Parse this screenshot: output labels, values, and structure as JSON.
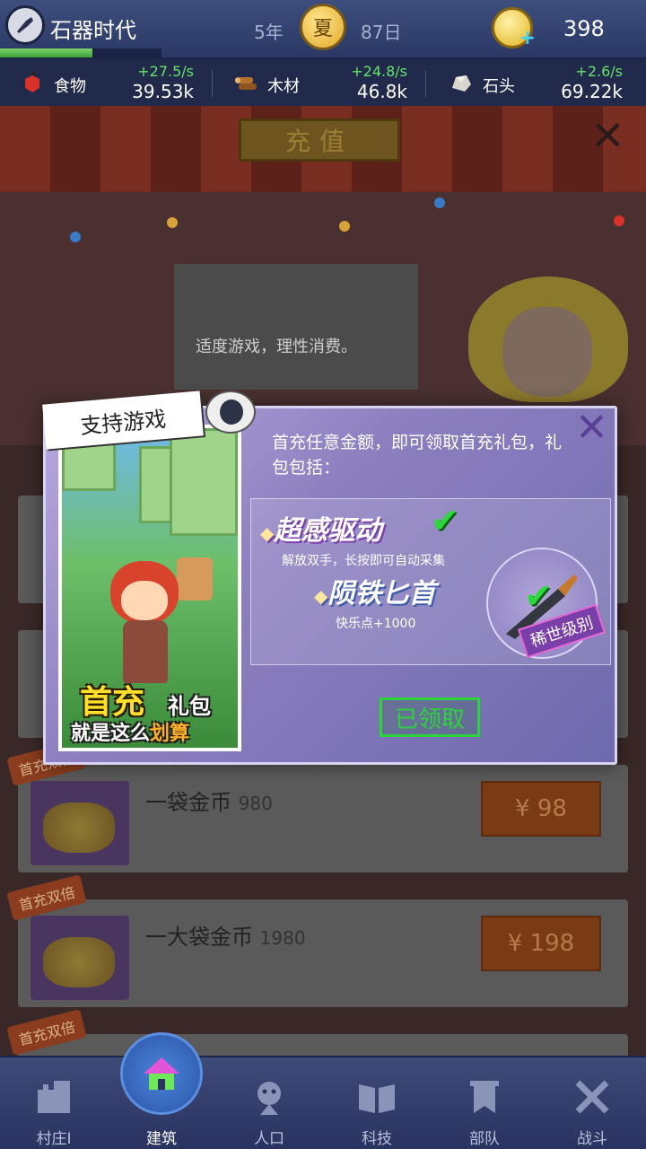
{
  "top_bar": {
    "game_title": "石器时代",
    "year": "5年",
    "season": "夏",
    "day": "87日",
    "gold": "398",
    "xp_progress": 0.57
  },
  "resources": [
    {
      "name": "食物",
      "rate": "+27.5/s",
      "amount": "39.53k",
      "icon": "apple-icon"
    },
    {
      "name": "木材",
      "rate": "+24.8/s",
      "amount": "46.8k",
      "icon": "wood-logs-icon"
    },
    {
      "name": "石头",
      "rate": "+2.6/s",
      "amount": "69.22k",
      "icon": "stone-icon"
    }
  ],
  "shop": {
    "sign": "充值",
    "notice": "适度游戏，理性消费。",
    "items": [
      {
        "tag": "首充双倍",
        "name": "一袋金币",
        "amount": "980",
        "price": "¥ 98"
      },
      {
        "tag": "首充双倍",
        "name": "一大袋金币",
        "amount": "1980",
        "price": "¥ 198"
      },
      {
        "tag": "首充双倍"
      }
    ]
  },
  "popup": {
    "support_tag": "支持游戏",
    "poster_line1a": "首充",
    "poster_line1b": "礼包",
    "poster_line2a": "就是这么",
    "poster_line2b": "划算",
    "description": "首充任意金额，即可领取首充礼包，礼包包括：",
    "reward1_title": "超感驱动",
    "reward1_desc": "解放双手，长按即可自动采集",
    "reward2_title": "陨铁匕首",
    "reward2_desc": "快乐点+1000",
    "rare_badge": "稀世级别",
    "claimed_button": "已领取"
  },
  "bottom_nav": [
    {
      "label": "村庄I",
      "icon": "castle-icon"
    },
    {
      "label": "建筑",
      "icon": "house-icon",
      "active": true
    },
    {
      "label": "人口",
      "icon": "person-icon"
    },
    {
      "label": "科技",
      "icon": "book-icon"
    },
    {
      "label": "部队",
      "icon": "banner-icon"
    },
    {
      "label": "战斗",
      "icon": "crossed-swords-icon"
    }
  ]
}
